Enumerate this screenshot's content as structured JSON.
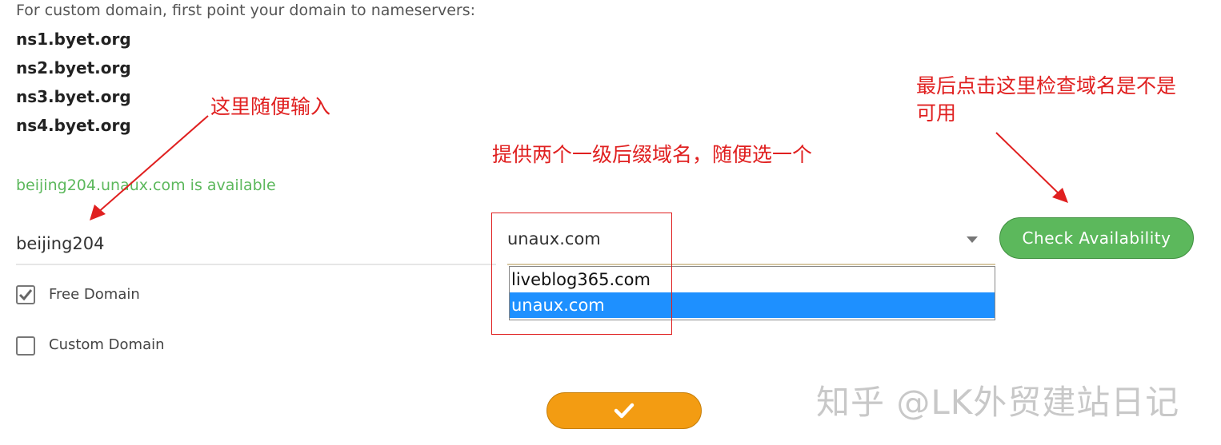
{
  "intro_text": "For custom domain, first point your domain to nameservers:",
  "nameservers": [
    "ns1.byet.org",
    "ns2.byet.org",
    "ns3.byet.org",
    "ns4.byet.org"
  ],
  "availability_message": "beijing204.unaux.com is available",
  "subdomain_input": {
    "value": "beijing204"
  },
  "domain_select": {
    "selected": "unaux.com",
    "options": [
      "liveblog365.com",
      "unaux.com"
    ],
    "selected_index": 1
  },
  "check_button_label": "Check Availability",
  "checkboxes": [
    {
      "label": "Free Domain",
      "checked": true
    },
    {
      "label": "Custom Domain",
      "checked": false
    }
  ],
  "submit_icon": "check-icon",
  "annotations": {
    "input_hint": "这里随便输入",
    "suffix_hint": "提供两个一级后缀域名，随便选一个",
    "check_hint_line1": "最后点击这里检查域名是不是",
    "check_hint_line2": "可用"
  },
  "watermark": "知乎 @LK外贸建站日记",
  "colors": {
    "success": "#5cb85c",
    "submit": "#f39c12",
    "selected_option": "#1e90ff",
    "annotation": "#e02020"
  }
}
